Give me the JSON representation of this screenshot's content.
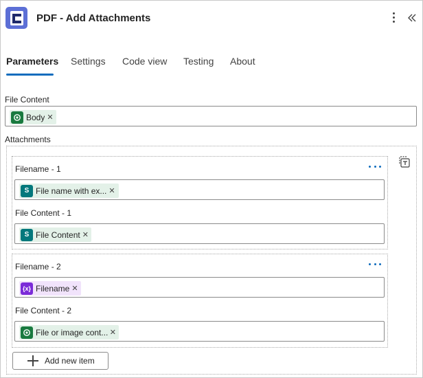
{
  "header": {
    "title": "PDF - Add Attachments",
    "app_icon": "pdf-connector-icon",
    "more_icon": "more-vertical-icon",
    "collapse_icon": "double-chevron-left-icon"
  },
  "tabs": [
    {
      "label": "Parameters",
      "active": true
    },
    {
      "label": "Settings",
      "active": false
    },
    {
      "label": "Code view",
      "active": false
    },
    {
      "label": "Testing",
      "active": false
    },
    {
      "label": "About",
      "active": false
    }
  ],
  "file_content": {
    "label": "File Content",
    "token": {
      "label": "Body",
      "icon": "dataverse-icon",
      "color": "#197a3f"
    }
  },
  "attachments": {
    "label": "Attachments",
    "switch_icon": "switch-to-text-mode-icon",
    "items": [
      {
        "filename_label": "Filename - 1",
        "filename_token": {
          "label": "File name with ex...",
          "icon": "sharepoint-icon",
          "color": "#03787c"
        },
        "content_label": "File Content - 1",
        "content_token": {
          "label": "File Content",
          "icon": "sharepoint-icon",
          "color": "#03787c"
        }
      },
      {
        "filename_label": "Filename - 2",
        "filename_token": {
          "label": "Filename",
          "icon": "variable-icon",
          "color": "#7b2bd8"
        },
        "content_label": "File Content - 2",
        "content_token": {
          "label": "File or image cont...",
          "icon": "dataverse-icon",
          "color": "#197a3f"
        }
      }
    ],
    "add_label": "Add new item"
  },
  "colors": {
    "accent": "#0f6cbd",
    "token_green_bg": "#e3f1e8",
    "token_purple_bg": "#f1e3fb"
  }
}
